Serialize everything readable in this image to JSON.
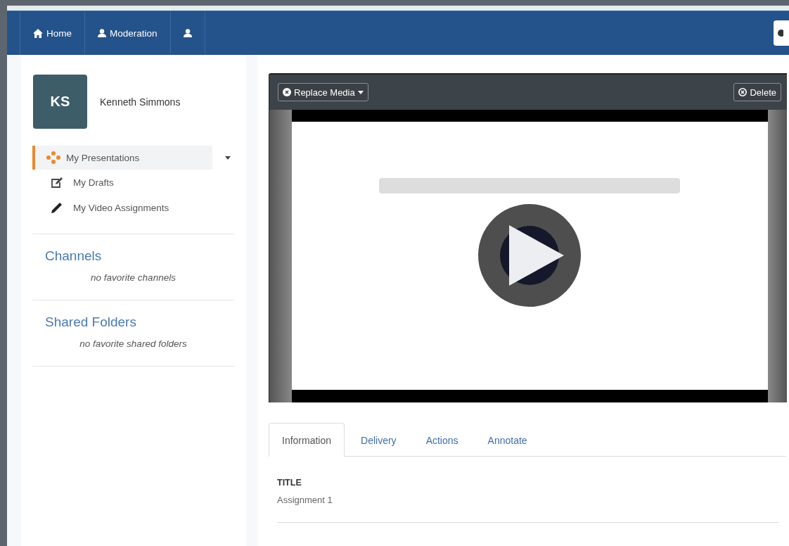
{
  "nav": {
    "items": [
      {
        "kind": "home",
        "label": "Home"
      },
      {
        "kind": "user",
        "label": "Moderation"
      },
      {
        "kind": "user"
      }
    ]
  },
  "profile": {
    "initials": "KS",
    "name": "Kenneth Simmons"
  },
  "sidebar": {
    "items": [
      {
        "kind": "presentations",
        "label": "My Presentations",
        "selected": true
      },
      {
        "kind": "draft",
        "label": "My Drafts",
        "selected": false
      },
      {
        "kind": "assignment",
        "label": "My Video Assignments",
        "selected": false
      }
    ],
    "sections": [
      {
        "title": "Channels",
        "empty_text": "no favorite channels"
      },
      {
        "title": "Shared Folders",
        "empty_text": "no favorite shared folders"
      }
    ]
  },
  "media": {
    "toolbar": {
      "replace": "Replace Media",
      "delete": "Delete"
    },
    "kind": "picture"
  },
  "tabs": [
    {
      "label": "Information",
      "selected": true
    },
    {
      "label": "Delivery",
      "selected": false
    },
    {
      "label": "Actions",
      "selected": false
    },
    {
      "label": "Annotate",
      "selected": false
    }
  ],
  "fields": [
    {
      "label": "TITLE",
      "value": "Assignment 1"
    }
  ]
}
